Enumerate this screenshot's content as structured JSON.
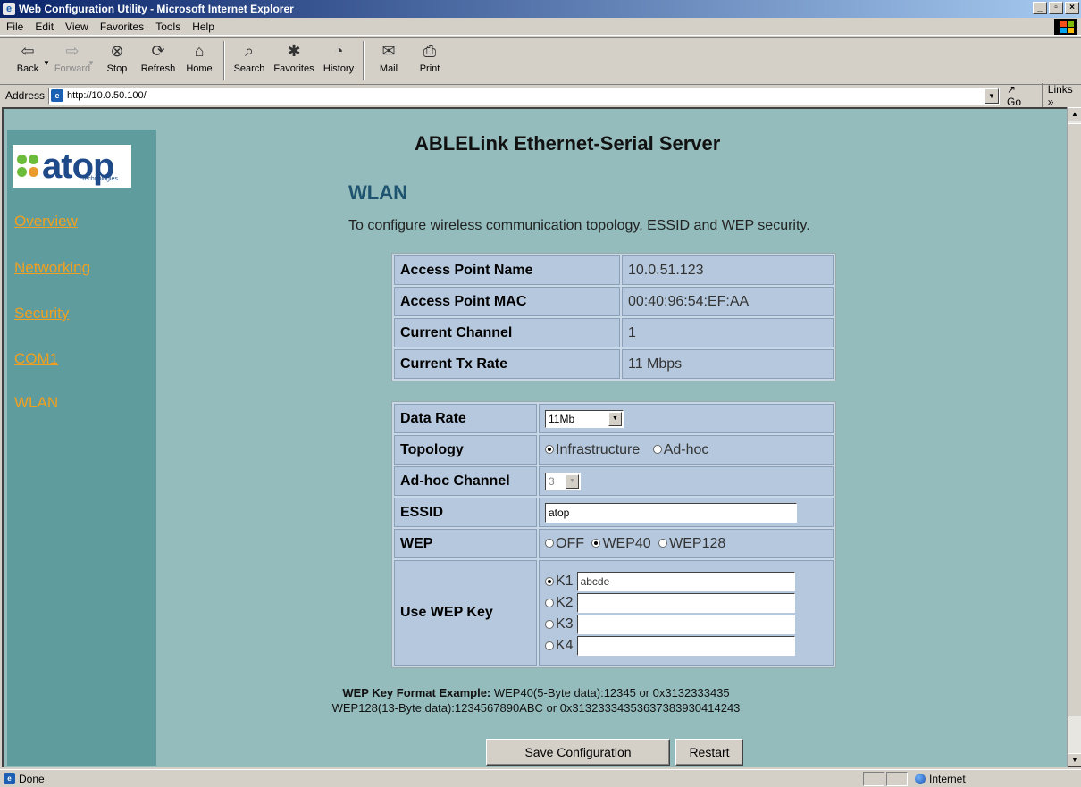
{
  "window": {
    "title": "Web Configuration Utility - Microsoft Internet Explorer"
  },
  "menu": [
    "File",
    "Edit",
    "View",
    "Favorites",
    "Tools",
    "Help"
  ],
  "toolbar": {
    "back": "Back",
    "forward": "Forward",
    "stop": "Stop",
    "refresh": "Refresh",
    "home": "Home",
    "search": "Search",
    "favorites": "Favorites",
    "history": "History",
    "mail": "Mail",
    "print": "Print"
  },
  "address": {
    "label": "Address",
    "url": "http://10.0.50.100/",
    "go": "Go",
    "links": "Links »"
  },
  "logo": {
    "word": "atop",
    "sub": "Technologies"
  },
  "nav": [
    "Overview",
    "Networking",
    "Security",
    "COM1",
    "WLAN"
  ],
  "page": {
    "title": "ABLELink Ethernet-Serial Server",
    "section": "WLAN",
    "description": "To configure wireless communication topology, ESSID and WEP security."
  },
  "info_table": [
    {
      "key": "Access Point Name",
      "value": "10.0.51.123"
    },
    {
      "key": "Access Point MAC",
      "value": "00:40:96:54:EF:AA"
    },
    {
      "key": "Current Channel",
      "value": "1"
    },
    {
      "key": "Current Tx Rate",
      "value": "11 Mbps"
    }
  ],
  "config": {
    "data_rate": {
      "label": "Data Rate",
      "value": "11Mb"
    },
    "topology": {
      "label": "Topology",
      "opt1": "Infrastructure",
      "opt2": "Ad-hoc"
    },
    "adhoc_channel": {
      "label": "Ad-hoc Channel",
      "value": "3"
    },
    "essid": {
      "label": "ESSID",
      "value": "atop"
    },
    "wep": {
      "label": "WEP",
      "opt1": "OFF",
      "opt2": "WEP40",
      "opt3": "WEP128"
    },
    "wep_key": {
      "label": "Use WEP Key",
      "k1": "K1",
      "k2": "K2",
      "k3": "K3",
      "k4": "K4",
      "k1_value": "abcde"
    }
  },
  "hint": {
    "bold": "WEP Key Format Example:",
    "line1": " WEP40(5-Byte data):12345 or 0x3132333435",
    "line2": "WEP128(13-Byte data):1234567890ABC or 0x31323334353637383930414243"
  },
  "buttons": {
    "save": "Save Configuration",
    "restart": "Restart"
  },
  "status": {
    "text": "Done",
    "zone": "Internet"
  }
}
